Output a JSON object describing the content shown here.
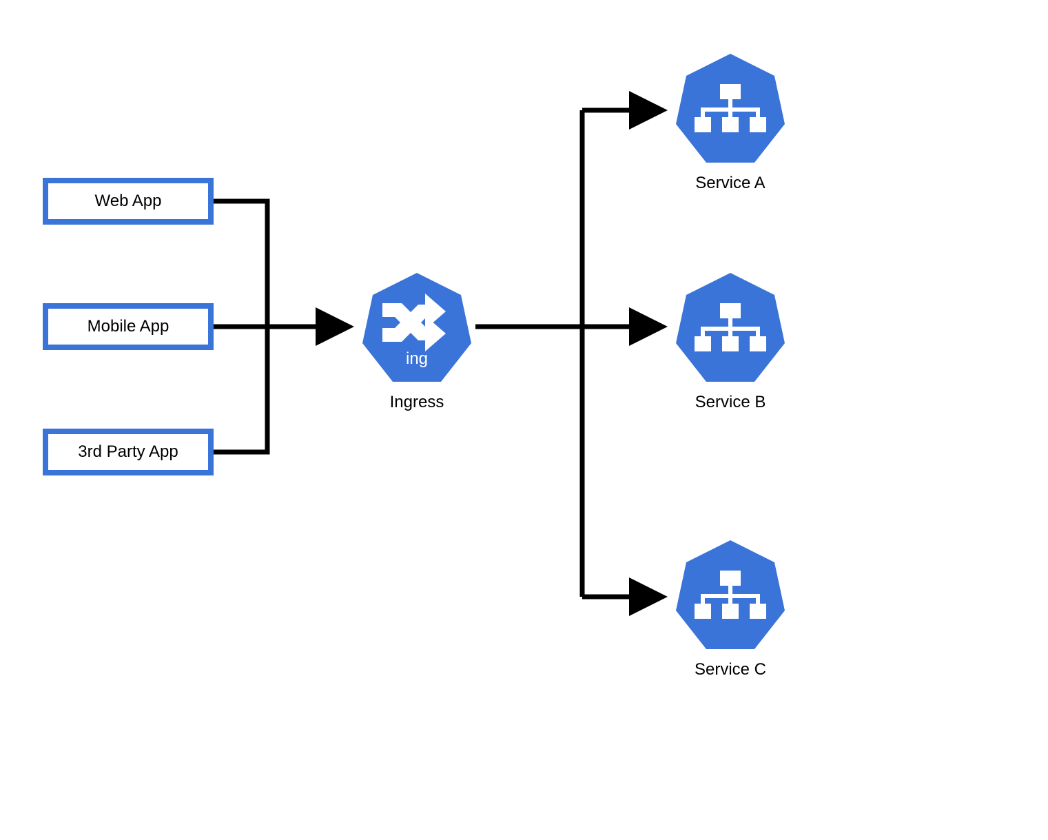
{
  "clients": {
    "web": {
      "label": "Web App"
    },
    "mobile": {
      "label": "Mobile App"
    },
    "third": {
      "label": "3rd Party App"
    }
  },
  "ingress": {
    "label": "Ingress",
    "inner_label": "ing"
  },
  "services": {
    "a": {
      "label": "Service A"
    },
    "b": {
      "label": "Service B"
    },
    "c": {
      "label": "Service C"
    }
  },
  "colors": {
    "node_blue": "#3b74d8",
    "arrow": "#000000"
  }
}
